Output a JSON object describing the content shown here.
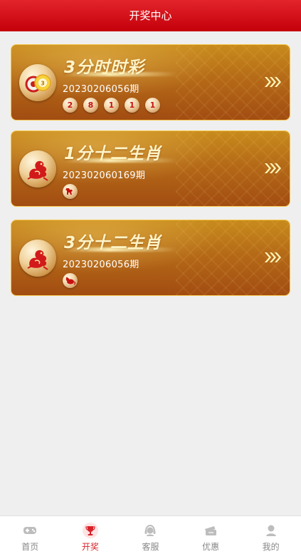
{
  "header": {
    "title": "开奖中心"
  },
  "cards": [
    {
      "title": "3分时时彩",
      "period": "20230206056期",
      "balls": [
        "2",
        "8",
        "1",
        "1",
        "1"
      ],
      "icon": "lottery-balls-icon"
    },
    {
      "title": "1分十二生肖",
      "period": "202302060169期",
      "zodiac": [
        "dog"
      ],
      "icon": "dragon-icon"
    },
    {
      "title": "3分十二生肖",
      "period": "20230206056期",
      "zodiac": [
        "rat"
      ],
      "icon": "dragon-icon"
    }
  ],
  "tabbar": {
    "items": [
      {
        "label": "首页",
        "icon": "gamepad-icon",
        "active": false
      },
      {
        "label": "开奖",
        "icon": "trophy-icon",
        "active": true
      },
      {
        "label": "客服",
        "icon": "customer-service-icon",
        "active": false
      },
      {
        "label": "优惠",
        "icon": "ticket-icon",
        "active": false
      },
      {
        "label": "我的",
        "icon": "user-icon",
        "active": false
      }
    ]
  },
  "colors": {
    "header": "#d8141c",
    "card_border": "#f6c64a",
    "active_tab": "#d8222a",
    "ball_text": "#c81010"
  }
}
